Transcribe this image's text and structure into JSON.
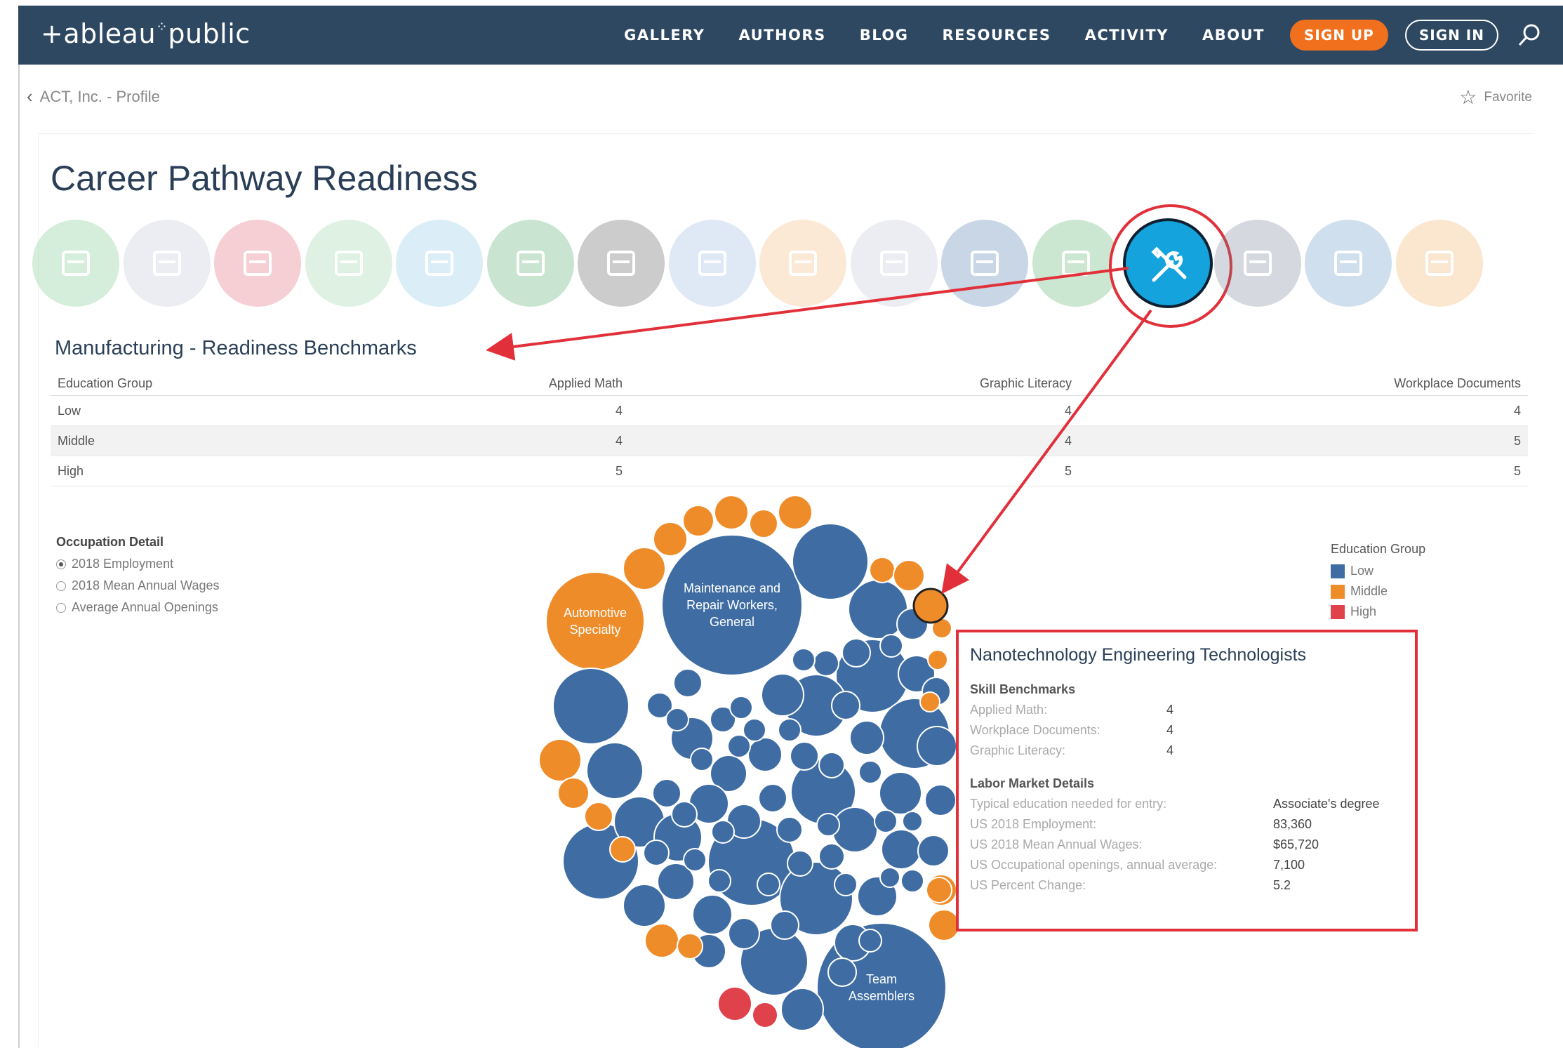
{
  "nav": {
    "logo": "+ableau⁠⁙public",
    "links": [
      "GALLERY",
      "AUTHORS",
      "BLOG",
      "RESOURCES",
      "ACTIVITY",
      "ABOUT"
    ],
    "signup_label": "SIGN UP",
    "signin_label": "SIGN IN"
  },
  "breadcrumb": {
    "label": "ACT, Inc. - Profile"
  },
  "favorite": {
    "label": "Favorite"
  },
  "page_title": "Career Pathway Readiness",
  "icon_row": [
    {
      "name": "plant-icon",
      "color": "#6abf82"
    },
    {
      "name": "brick-wall-icon",
      "color": "#b8c2d6"
    },
    {
      "name": "megaphone-icon",
      "color": "#e0566b"
    },
    {
      "name": "presentation-icon",
      "color": "#8ccf9a"
    },
    {
      "name": "graduation-cap-icon",
      "color": "#7fc3e6"
    },
    {
      "name": "money-icon",
      "color": "#3fa65d"
    },
    {
      "name": "government-building-icon",
      "color": "#4b4b4b"
    },
    {
      "name": "syringe-icon",
      "color": "#8fb4e2"
    },
    {
      "name": "hospitality-icon",
      "color": "#f3b16e"
    },
    {
      "name": "people-icon",
      "color": "#b8c2d6"
    },
    {
      "name": "computer-user-icon",
      "color": "#3d6ea8"
    },
    {
      "name": "law-icon",
      "color": "#4caa5e"
    },
    {
      "name": "manufacturing-tools-icon",
      "color": "#15a3dd",
      "active": true
    },
    {
      "name": "marketing-chart-icon",
      "color": "#6b7b8e"
    },
    {
      "name": "science-gear-icon",
      "color": "#5a8fc4"
    },
    {
      "name": "transportation-truck-icon",
      "color": "#f2a857"
    }
  ],
  "benchmarks": {
    "title": "Manufacturing - Readiness Benchmarks",
    "headers": [
      "Education Group",
      "Applied Math",
      "Graphic Literacy",
      "Workplace Documents"
    ],
    "rows": [
      [
        "Low",
        "4",
        "4",
        "4"
      ],
      [
        "Middle",
        "4",
        "4",
        "5"
      ],
      [
        "High",
        "5",
        "5",
        "5"
      ]
    ]
  },
  "occupation_detail": {
    "heading": "Occupation Detail",
    "options": [
      "2018 Employment",
      "2018 Mean Annual Wages",
      "Average Annual Openings"
    ],
    "selected": "2018 Employment"
  },
  "legend": {
    "heading": "Education Group",
    "items": [
      {
        "label": "Low",
        "color": "#3f6da3"
      },
      {
        "label": "Middle",
        "color": "#ef8c2a"
      },
      {
        "label": "High",
        "color": "#e0424c"
      }
    ]
  },
  "bubble_labels": {
    "automotive": [
      "Automotive",
      "Specialty"
    ],
    "maintenance": [
      "Maintenance and",
      "Repair Workers,",
      "General"
    ],
    "team": [
      "Team",
      "Assemblers"
    ]
  },
  "tooltip": {
    "title": "Nanotechnology Engineering Technologists",
    "skill_heading": "Skill Benchmarks",
    "skills": [
      {
        "label": "Applied Math:",
        "value": "4"
      },
      {
        "label": "Workplace Documents:",
        "value": "4"
      },
      {
        "label": "Graphic Literacy:",
        "value": "4"
      }
    ],
    "labor_heading": "Labor Market Details",
    "labor": [
      {
        "label": "Typical education needed for entry:",
        "value": "Associate's degree"
      },
      {
        "label": "US 2018 Employment:",
        "value": "83,360"
      },
      {
        "label": "US 2018 Mean Annual Wages:",
        "value": "$65,720"
      },
      {
        "label": "US Occupational openings, annual average:",
        "value": "7,100"
      },
      {
        "label": "US Percent Change:",
        "value": "5.2"
      }
    ]
  },
  "colors": {
    "nav_bg": "#2f4862",
    "accent_orange": "#f0701d",
    "low": "#3f6da3",
    "middle": "#ef8c2a",
    "high": "#e0424c",
    "highlight_red": "#e2303a"
  }
}
